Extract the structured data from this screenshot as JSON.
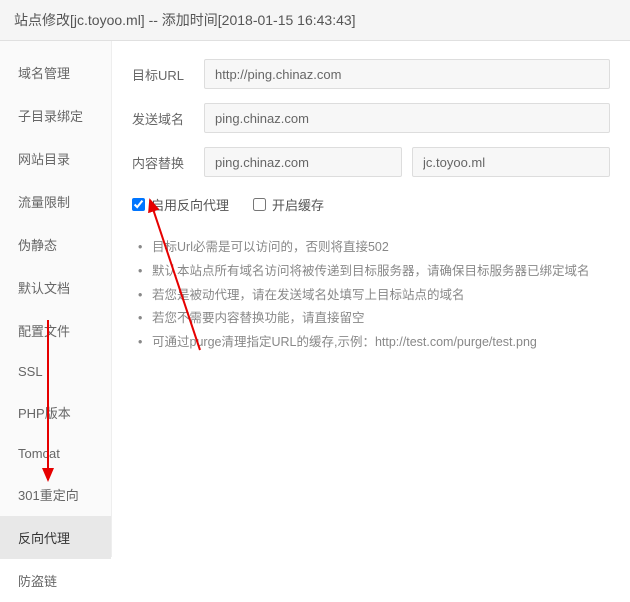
{
  "header": {
    "title": "站点修改[jc.toyoo.ml] -- 添加时间[2018-01-15 16:43:43]"
  },
  "sidebar": {
    "items": [
      {
        "label": "域名管理"
      },
      {
        "label": "子目录绑定"
      },
      {
        "label": "网站目录"
      },
      {
        "label": "流量限制"
      },
      {
        "label": "伪静态"
      },
      {
        "label": "默认文档"
      },
      {
        "label": "配置文件"
      },
      {
        "label": "SSL"
      },
      {
        "label": "PHP版本"
      },
      {
        "label": "Tomcat"
      },
      {
        "label": "301重定向"
      },
      {
        "label": "反向代理"
      },
      {
        "label": "防盗链"
      }
    ]
  },
  "form": {
    "target_url_label": "目标URL",
    "target_url_value": "http://ping.chinaz.com",
    "send_domain_label": "发送域名",
    "send_domain_value": "ping.chinaz.com",
    "content_replace_label": "内容替换",
    "content_replace_from": "ping.chinaz.com",
    "content_replace_to": "jc.toyoo.ml",
    "enable_proxy_label": "启用反向代理",
    "enable_cache_label": "开启缓存"
  },
  "tips": [
    "目标Url必需是可以访问的，否则将直接502",
    "默认本站点所有域名访问将被传递到目标服务器，请确保目标服务器已绑定域名",
    "若您是被动代理，请在发送域名处填写上目标站点的域名",
    "若您不需要内容替换功能，请直接留空",
    "可通过purge清理指定URL的缓存,示例：http://test.com/purge/test.png"
  ]
}
